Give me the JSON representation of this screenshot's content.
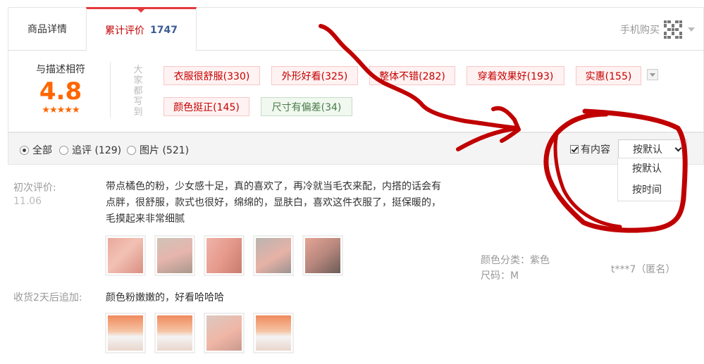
{
  "tabs": {
    "detail_label": "商品详情",
    "reviews_label": "累计评价",
    "reviews_count": "1747",
    "mobile_buy": "手机购买"
  },
  "summary": {
    "score_label": "与描述相符",
    "score": "4.8",
    "stars": "★★★★★",
    "everyone_wrote": [
      "大",
      "家",
      "都",
      "写",
      "到"
    ],
    "tags": [
      {
        "text": "衣服很舒服(330)",
        "kind": "positive"
      },
      {
        "text": "外形好看(325)",
        "kind": "positive"
      },
      {
        "text": "整体不错(282)",
        "kind": "positive"
      },
      {
        "text": "穿着效果好(193)",
        "kind": "positive"
      },
      {
        "text": "实惠(155)",
        "kind": "positive"
      },
      {
        "text": "颜色挺正(145)",
        "kind": "positive"
      },
      {
        "text": "尺寸有偏差(34)",
        "kind": "negative"
      }
    ]
  },
  "filters": {
    "all": "全部",
    "followup": "追评 (129)",
    "pictures": "图片 (521)",
    "has_content": "有内容",
    "sort_selected": "按默认",
    "sort_options": [
      "按默认",
      "按时间"
    ]
  },
  "review": {
    "first_label": "初次评价:",
    "first_date": "11.06",
    "text": "带点橘色的粉，少女感十足，真的喜欢了，再冷就当毛衣来配，内搭的话会有点胖，很舒服，款式也很好，绵绵的，显肤白，喜欢这件衣服了，挺保暖的，毛摸起来非常细腻",
    "sku_color": "颜色分类：紫色",
    "sku_size": "尺码：M",
    "user": "t***7（匿名）",
    "append_label": "收货2天后追加:",
    "append_text": "颜色粉嫩嫩的，好看哈哈哈"
  },
  "colors": {
    "accent": "#c40000",
    "tab_top": "#e4393c",
    "score": "#ff6600",
    "annotation": "#c00000"
  }
}
